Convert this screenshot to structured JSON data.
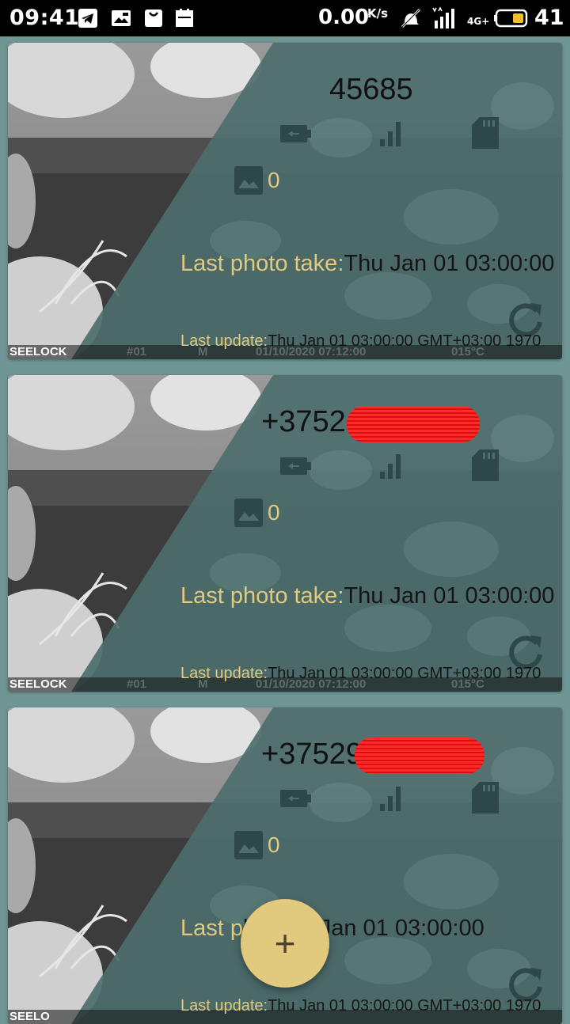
{
  "statusbar": {
    "time": "09:41",
    "net_speed": "0.00",
    "net_unit": "K/s",
    "network": "4G+",
    "battery": "41",
    "icons": [
      "telegram-icon",
      "photo-notification-icon",
      "bag-icon",
      "calendar-icon",
      "mute-icon",
      "signal-icon",
      "battery-icon"
    ]
  },
  "colors": {
    "accent": "#e1c97d",
    "card_overlay": "#4d6e6d",
    "background": "#6f9694",
    "redaction": "#ff2a2a"
  },
  "cards": [
    {
      "phone": "45685",
      "photo_count": "0",
      "last_photo_label": "Last photo take:",
      "last_photo_value": "Thu Jan 01 03:00:00",
      "last_update_label": "Last update:",
      "last_update_value": "Thu Jan 01 03:00:00 GMT+03:00 1970",
      "cam_brand": "SEELOCK",
      "cam_id": "#01",
      "cam_mode": "M",
      "cam_date": "01/10/2020 07:12:00",
      "cam_temp": "015°C"
    },
    {
      "phone": "+3752",
      "photo_count": "0",
      "last_photo_label": "Last photo take:",
      "last_photo_value": "Thu Jan 01 03:00:00",
      "last_update_label": "Last update:",
      "last_update_value": "Thu Jan 01 03:00:00 GMT+03:00 1970",
      "cam_brand": "SEELOCK",
      "cam_id": "#01",
      "cam_mode": "M",
      "cam_date": "01/10/2020 07:12:00",
      "cam_temp": "015°C"
    },
    {
      "phone": "+37529",
      "photo_count": "0",
      "last_photo_label": "Last p",
      "last_photo_value": "ke:Thu Jan 01 03:00:00",
      "last_update_label": "Last update:",
      "last_update_value": "Thu Jan 01 03:00:00 GMT+03:00 1970",
      "cam_brand": "SEELO",
      "cam_id": "",
      "cam_mode": "",
      "cam_date": "",
      "cam_temp": ""
    }
  ],
  "fab": {
    "label": "+"
  }
}
